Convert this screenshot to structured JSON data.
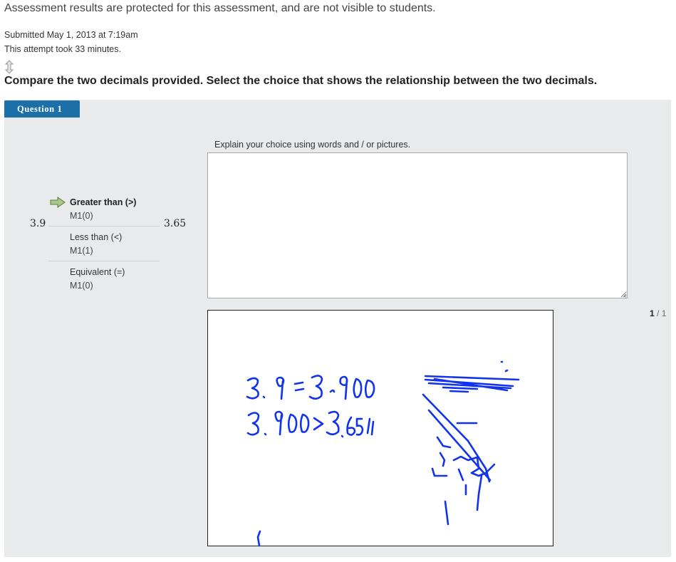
{
  "notice": "Assessment results are protected for this assessment, and are not visible to students.",
  "submission": {
    "submitted": "Submitted May 1, 2013 at 7:19am",
    "duration": "This attempt took 33 minutes."
  },
  "question": {
    "prompt": "Compare the two decimals provided. Select the choice that shows the relationship between the two decimals.",
    "tab_label": "Question 1",
    "left_value": "3.9",
    "right_value": "3.65",
    "choices": [
      {
        "label": "Greater than (>)",
        "score": "M1(0)",
        "selected": true
      },
      {
        "label": "Less than (<)",
        "score": "M1(1)",
        "selected": false
      },
      {
        "label": "Equivalent (=)",
        "score": "M1(0)",
        "selected": false
      }
    ],
    "explain_label": "Explain your choice using words and / or pictures.",
    "explain_value": "",
    "pager": {
      "current": "1",
      "total": "/ 1"
    }
  },
  "colors": {
    "tab": "#1d6fa8",
    "panel": "#e9eaec",
    "ink": "#1133ee",
    "arrow": "#a8c98a"
  },
  "icons": [
    "sort-arrows-icon",
    "selected-arrow-icon",
    "resize-grip-icon"
  ]
}
